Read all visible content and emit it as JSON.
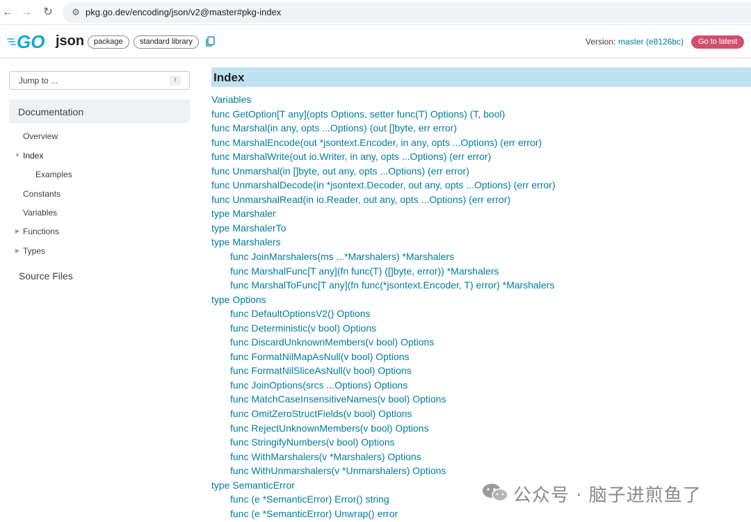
{
  "browser": {
    "back_icon": "back-arrow-icon",
    "forward_icon": "forward-arrow-icon",
    "reload_icon": "reload-icon",
    "url": "pkg.go.dev/encoding/json/v2@master#pkg-index"
  },
  "header": {
    "logo": "GO",
    "package_name": "json",
    "chip_package": "package",
    "chip_stdlib": "standard library",
    "version_label": "Version:",
    "version_value": "master (e8126bc)",
    "goto_latest": "Go to latest",
    "brand_color": "#00ADD8",
    "goto_color": "#D04F6D"
  },
  "sidebar": {
    "jump_placeholder": "Jump to ...",
    "jump_shortcut": "f",
    "documentation": "Documentation",
    "items": [
      {
        "label": "Overview"
      },
      {
        "label": "Index"
      },
      {
        "label": "Examples"
      },
      {
        "label": "Constants"
      },
      {
        "label": "Variables"
      },
      {
        "label": "Functions"
      },
      {
        "label": "Types"
      }
    ],
    "source_files": "Source Files"
  },
  "main": {
    "index_title": "Index",
    "items": [
      {
        "text": "Variables",
        "level": 1
      },
      {
        "text": "func GetOption[T any](opts Options, setter func(T) Options) (T, bool)",
        "level": 1
      },
      {
        "text": "func Marshal(in any, opts ...Options) (out []byte, err error)",
        "level": 1
      },
      {
        "text": "func MarshalEncode(out *jsontext.Encoder, in any, opts ...Options) (err error)",
        "level": 1
      },
      {
        "text": "func MarshalWrite(out io.Writer, in any, opts ...Options) (err error)",
        "level": 1
      },
      {
        "text": "func Unmarshal(in []byte, out any, opts ...Options) (err error)",
        "level": 1
      },
      {
        "text": "func UnmarshalDecode(in *jsontext.Decoder, out any, opts ...Options) (err error)",
        "level": 1
      },
      {
        "text": "func UnmarshalRead(in io.Reader, out any, opts ...Options) (err error)",
        "level": 1
      },
      {
        "text": "type Marshaler",
        "level": 1
      },
      {
        "text": "type MarshalerTo",
        "level": 1
      },
      {
        "text": "type Marshalers",
        "level": 1
      },
      {
        "text": "func JoinMarshalers(ms ...*Marshalers) *Marshalers",
        "level": 2
      },
      {
        "text": "func MarshalFunc[T any](fn func(T) ([]byte, error)) *Marshalers",
        "level": 2
      },
      {
        "text": "func MarshalToFunc[T any](fn func(*jsontext.Encoder, T) error) *Marshalers",
        "level": 2
      },
      {
        "text": "type Options",
        "level": 1
      },
      {
        "text": "func DefaultOptionsV2() Options",
        "level": 2
      },
      {
        "text": "func Deterministic(v bool) Options",
        "level": 2
      },
      {
        "text": "func DiscardUnknownMembers(v bool) Options",
        "level": 2
      },
      {
        "text": "func FormatNilMapAsNull(v bool) Options",
        "level": 2
      },
      {
        "text": "func FormatNilSliceAsNull(v bool) Options",
        "level": 2
      },
      {
        "text": "func JoinOptions(srcs ...Options) Options",
        "level": 2
      },
      {
        "text": "func MatchCaseInsensitiveNames(v bool) Options",
        "level": 2
      },
      {
        "text": "func OmitZeroStructFields(v bool) Options",
        "level": 2
      },
      {
        "text": "func RejectUnknownMembers(v bool) Options",
        "level": 2
      },
      {
        "text": "func StringifyNumbers(v bool) Options",
        "level": 2
      },
      {
        "text": "func WithMarshalers(v *Marshalers) Options",
        "level": 2
      },
      {
        "text": "func WithUnmarshalers(v *Unmarshalers) Options",
        "level": 2
      },
      {
        "text": "type SemanticError",
        "level": 1
      },
      {
        "text": "func (e *SemanticError) Error() string",
        "level": 2
      },
      {
        "text": "func (e *SemanticError) Unwrap() error",
        "level": 2
      }
    ],
    "link_color": "#007D9C",
    "index_bar_color": "#BFE3F0"
  },
  "watermark": {
    "text": "公众号 · 脑子进煎鱼了"
  }
}
